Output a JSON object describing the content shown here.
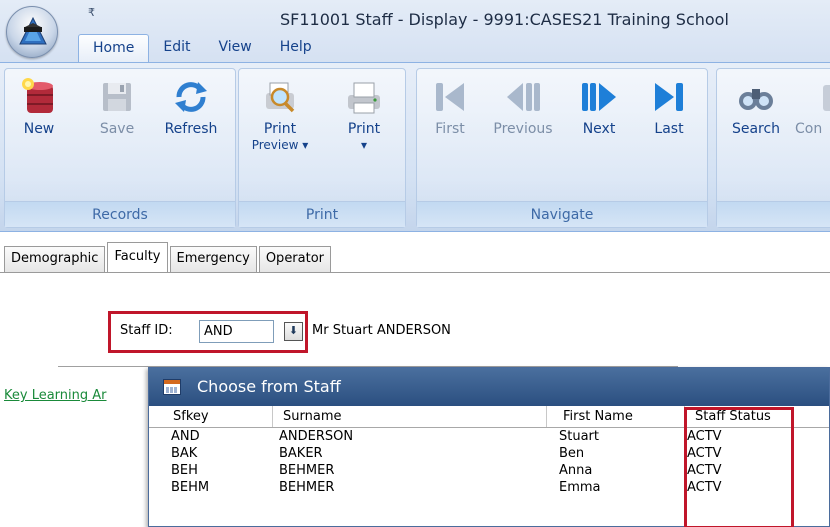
{
  "window": {
    "title": "SF11001 Staff - Display - 9991:CASES21 Training School",
    "quick_access_glyph": "₹"
  },
  "ribbon_tabs": [
    {
      "label": "Home",
      "active": true
    },
    {
      "label": "Edit",
      "active": false
    },
    {
      "label": "View",
      "active": false
    },
    {
      "label": "Help",
      "active": false
    }
  ],
  "ribbon_groups": {
    "records": {
      "label": "Records",
      "buttons": [
        {
          "label": "New",
          "icon": "database-new-icon",
          "enabled": true
        },
        {
          "label": "Save",
          "icon": "save-disk-icon",
          "enabled": false
        },
        {
          "label": "Refresh",
          "icon": "refresh-arrows-icon",
          "enabled": true
        }
      ]
    },
    "print": {
      "label": "Print",
      "buttons": [
        {
          "label": "Print",
          "label2": "Preview ▾",
          "icon": "print-preview-icon",
          "enabled": true
        },
        {
          "label": "Print",
          "label2": "▾",
          "icon": "printer-icon",
          "enabled": true
        }
      ]
    },
    "navigate": {
      "label": "Navigate",
      "buttons": [
        {
          "label": "First",
          "icon": "first-record-icon",
          "enabled": false
        },
        {
          "label": "Previous",
          "icon": "previous-record-icon",
          "enabled": false
        },
        {
          "label": "Next",
          "icon": "next-record-icon",
          "enabled": true
        },
        {
          "label": "Last",
          "icon": "last-record-icon",
          "enabled": true
        }
      ]
    },
    "search": {
      "buttons": [
        {
          "label": "Search",
          "icon": "binoculars-icon",
          "enabled": true
        },
        {
          "label": "Con",
          "icon": "context-icon",
          "enabled": false
        }
      ]
    }
  },
  "form_tabs": [
    {
      "label": "Demographic",
      "active": false
    },
    {
      "label": "Faculty",
      "active": true
    },
    {
      "label": "Emergency",
      "active": false
    },
    {
      "label": "Operator",
      "active": false
    }
  ],
  "staff": {
    "label": "Staff ID:",
    "value": "AND",
    "dropdown_glyph": "⬇",
    "name": "Mr Stuart ANDERSON"
  },
  "key_learning_link": "Key Learning Ar",
  "chooser": {
    "title": "Choose from Staff",
    "columns": [
      "Sfkey",
      "Surname",
      "First Name",
      "Staff Status"
    ],
    "rows": [
      [
        "AND",
        "ANDERSON",
        "Stuart",
        "ACTV"
      ],
      [
        "BAK",
        "BAKER",
        "Ben",
        "ACTV"
      ],
      [
        "BEH",
        "BEHMER",
        "Anna",
        "ACTV"
      ],
      [
        "BEHM",
        "BEHMER",
        "Emma",
        "ACTV"
      ]
    ]
  },
  "colors": {
    "highlight_border": "#c0162a",
    "ribbon_text": "#15428b",
    "link": "#1a8a3a",
    "popup_title_bg": "#2b4f80"
  }
}
